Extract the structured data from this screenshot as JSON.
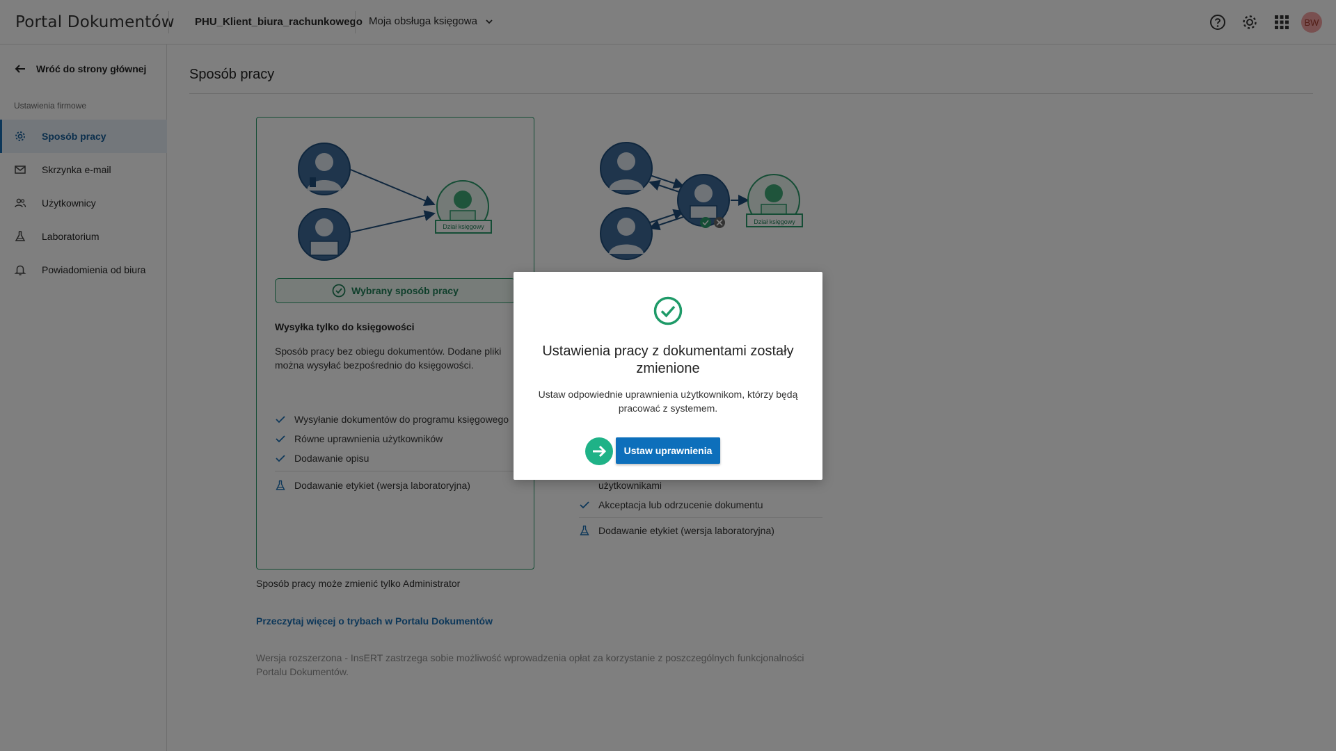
{
  "header": {
    "app_title": "Portal Dokumentów",
    "client_name": "PHU_Klient_biura_rachunkowego",
    "service_label": "Moja obsługa księgowa",
    "avatar_initials": "BW"
  },
  "sidebar": {
    "back_label": "Wróć do strony głównej",
    "section_label": "Ustawienia firmowe",
    "items": [
      {
        "label": "Sposób pracy",
        "icon": "gear-icon",
        "active": true
      },
      {
        "label": "Skrzynka e-mail",
        "icon": "mail-icon",
        "active": false
      },
      {
        "label": "Użytkownicy",
        "icon": "users-icon",
        "active": false
      },
      {
        "label": "Laboratorium",
        "icon": "flask-icon",
        "active": false
      },
      {
        "label": "Powiadomienia od biura",
        "icon": "bell-icon",
        "active": false
      }
    ]
  },
  "main": {
    "page_title": "Sposób pracy",
    "card_left": {
      "diagram_label": "Dział księgowy",
      "selected_label": "Wybrany sposób pracy",
      "heading": "Wysyłka tylko do księgowości",
      "description": "Sposób pracy bez obiegu dokumentów. Dodane pliki można wysyłać bezpośrednio do księgowości.",
      "features": [
        "Wysyłanie dokumentów do programu księgowego",
        "Równe uprawnienia użytkowników",
        "Dodawanie opisu"
      ],
      "lab_feature": "Dodawanie etykiet (wersja laboratoryjna)"
    },
    "card_right": {
      "diagram_label": "Dział księgowy",
      "features_partial": [
        "użytkownikami",
        "Akceptacja lub odrzucenie dokumentu"
      ],
      "lab_feature": "Dodawanie etykiet (wersja laboratoryjna)"
    },
    "admin_note": "Sposób pracy może zmienić tylko Administrator",
    "read_more": "Przeczytaj więcej o trybach w Portalu Dokumentów",
    "extended_note": "Wersja rozszerzona - InsERT zastrzega sobie możliwość wprowadzenia opłat za korzystanie z poszczególnych funkcjonalności Portalu Dokumentów."
  },
  "modal": {
    "title": "Ustawienia pracy z dokumentami zostały zmienione",
    "text": "Ustaw odpowiednie uprawnienia użytkownikom, którzy będą pracować z systemem.",
    "button_label": "Ustaw uprawnienia"
  },
  "colors": {
    "brand_blue": "#1a6fb3",
    "success_green": "#2a9a6a",
    "hint_green": "#1fb287",
    "avatar_bg": "#f2a1a1"
  }
}
